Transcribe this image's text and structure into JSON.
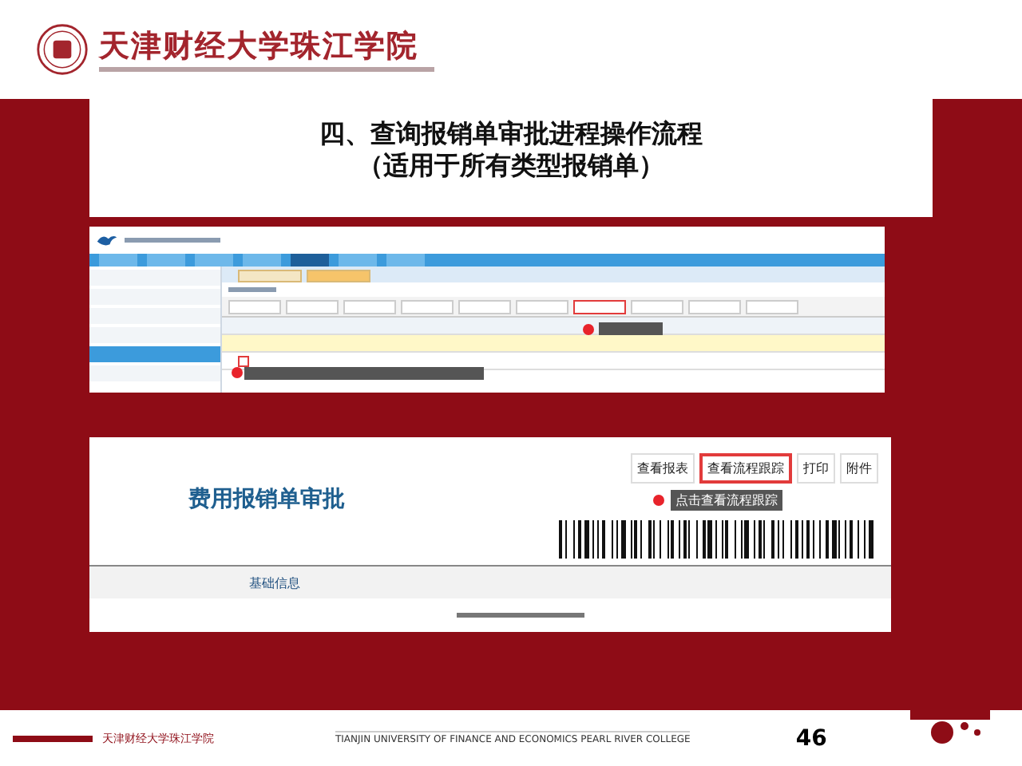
{
  "header": {
    "school_name": "天津财经大学珠江学院"
  },
  "title": {
    "lines": [
      "四、查询报销单审批进程操作流程",
      "（适用于所有类型报销单）"
    ]
  },
  "system_screen": {
    "nav": [
      {
        "selected": false
      },
      {
        "selected": false
      },
      {
        "selected": false
      },
      {
        "selected": false
      },
      {
        "selected": true
      },
      {
        "selected": false
      },
      {
        "selected": false
      }
    ],
    "sidebar": [
      {
        "selected": false
      },
      {
        "selected": false
      },
      {
        "selected": false
      },
      {
        "selected": false
      },
      {
        "selected": true
      },
      {
        "selected": false
      }
    ],
    "toolbar": [
      {
        "highlighted": false
      },
      {
        "highlighted": false
      },
      {
        "highlighted": false
      },
      {
        "highlighted": false
      },
      {
        "highlighted": false
      },
      {
        "highlighted": false
      },
      {
        "highlighted": true
      },
      {
        "highlighted": false
      },
      {
        "highlighted": false
      },
      {
        "highlighted": false
      }
    ]
  },
  "form_screen": {
    "heading": "费用报销单审批",
    "buttons": [
      {
        "label": "查看报表",
        "highlighted": false
      },
      {
        "label": "查看流程跟踪",
        "highlighted": true
      },
      {
        "label": "打印",
        "highlighted": false
      },
      {
        "label": "附件",
        "highlighted": false
      }
    ],
    "callout": "点击查看流程跟踪",
    "section_label": "基础信息"
  },
  "footer": {
    "school_name": "天津财经大学珠江学院",
    "english_name": "TIANJIN UNIVERSITY OF FINANCE AND ECONOMICS PEARL RIVER COLLEGE",
    "page_number": "46"
  }
}
